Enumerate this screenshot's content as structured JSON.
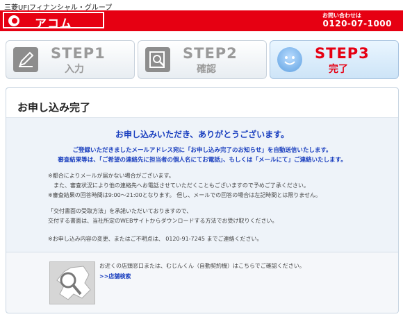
{
  "header": {
    "group_name": "三菱UFJフィナンシャル・グループ",
    "logo_text": "アコム",
    "contact_label": "お問い合わせは",
    "contact_number": "0120-07-1000"
  },
  "steps": [
    {
      "title": "STEP1",
      "sub": "入力",
      "icon": "pencil-icon",
      "state": "done"
    },
    {
      "title": "STEP2",
      "sub": "確認",
      "icon": "magnifier-icon",
      "state": "done"
    },
    {
      "title": "STEP3",
      "sub": "完了",
      "icon": "smile-icon",
      "state": "current"
    }
  ],
  "colors": {
    "brand_red": "#e60012",
    "link_blue": "#1a3fbf"
  },
  "main": {
    "title": "お申し込み完了",
    "thanks": "お申し込みいただき、ありがとうございます。",
    "intro_1": "ご登録いただきましたメールアドレス宛に「お申し込み完了のお知らせ」を自動送信いたします。",
    "intro_2": "審査結果等は、「ご希望の連絡先に担当者の個人名にてお電話」、もしくは「メールにて」ご連絡いたします。",
    "note_1": "※都合によりメールが届かない場合がございます。",
    "note_2": "　また、審査状況により他の連絡先へお電話させていただくこともございますので予めご了承ください。",
    "note_3": "※審査結果の回答時間は9:00～21:00となります。 但し、メールでの回答の場合は左記時間とは限りません。",
    "note_4": "「交付書面の受取方法」を承諾いただいておりますので、",
    "note_5": "交付する書面は、当社所定のWEBサイトからダウンロードする方法でお受け取りください。",
    "note_6": "※お申し込み内容の変更、またはご不明点は、 0120-91-7245 までご連絡ください。",
    "shop_text": "お近くの店頭窓口または、むじんくん（自動契約機）はこちらでご確認ください。",
    "shop_link": ">>店舗検索"
  }
}
